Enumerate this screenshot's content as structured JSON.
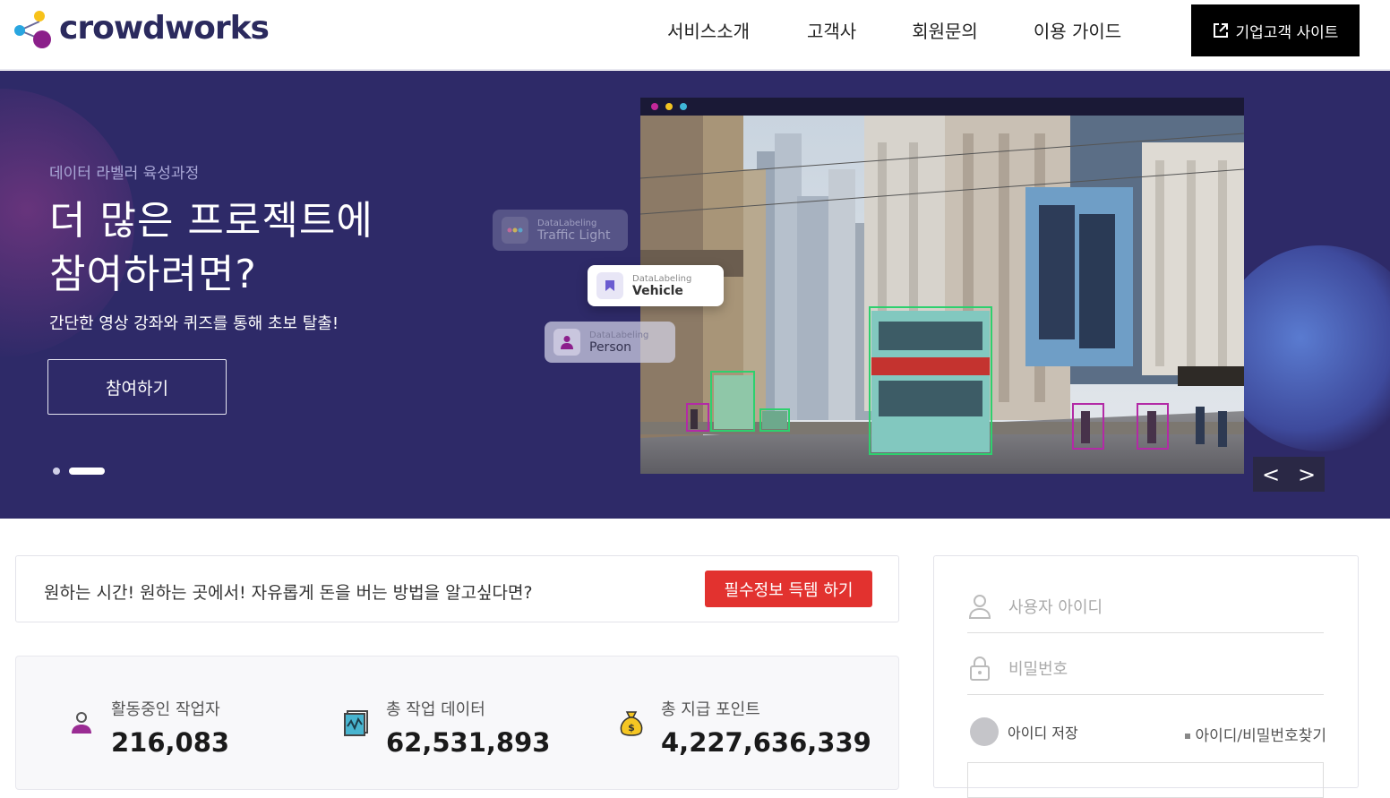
{
  "header": {
    "logo_text": "crowdworks",
    "nav": [
      "서비스소개",
      "고객사",
      "회원문의",
      "이용 가이드"
    ],
    "biz_site_label": "기업고객 사이트"
  },
  "hero": {
    "subtitle": "데이터 라벨러 육성과정",
    "title_line1": "더 많은 프로젝트에",
    "title_line2": "참여하려면?",
    "description": "간단한 영상 강좌와 퀴즈를 통해 초보 탈출!",
    "cta_label": "참여하기",
    "slide_count": 2,
    "active_slide": 2,
    "tags": [
      {
        "category": "DataLabeling",
        "name": "Traffic Light"
      },
      {
        "category": "DataLabeling",
        "name": "Vehicle"
      },
      {
        "category": "DataLabeling",
        "name": "Person"
      }
    ],
    "prev_arrow": "<",
    "next_arrow": ">"
  },
  "notice": {
    "text": "원하는 시간! 원하는 곳에서! 자유롭게 돈을 버는 방법을 알고싶다면?",
    "button_label": "필수정보 득템 하기"
  },
  "stats": [
    {
      "label": "활동중인 작업자",
      "value": "216,083",
      "icon": "person-icon"
    },
    {
      "label": "총 작업 데이터",
      "value": "62,531,893",
      "icon": "data-chart-icon"
    },
    {
      "label": "총 지급 포인트",
      "value": "4,227,636,339",
      "icon": "money-bag-icon"
    }
  ],
  "login": {
    "id_placeholder": "사용자 아이디",
    "pw_placeholder": "비밀번호",
    "save_id_label": "아이디 저장",
    "find_label": "아이디/비밀번호찾기"
  },
  "colors": {
    "hero_bg": "#2e2a68",
    "notice_button": "#e2322f",
    "logo_text": "#2b2a5e"
  }
}
